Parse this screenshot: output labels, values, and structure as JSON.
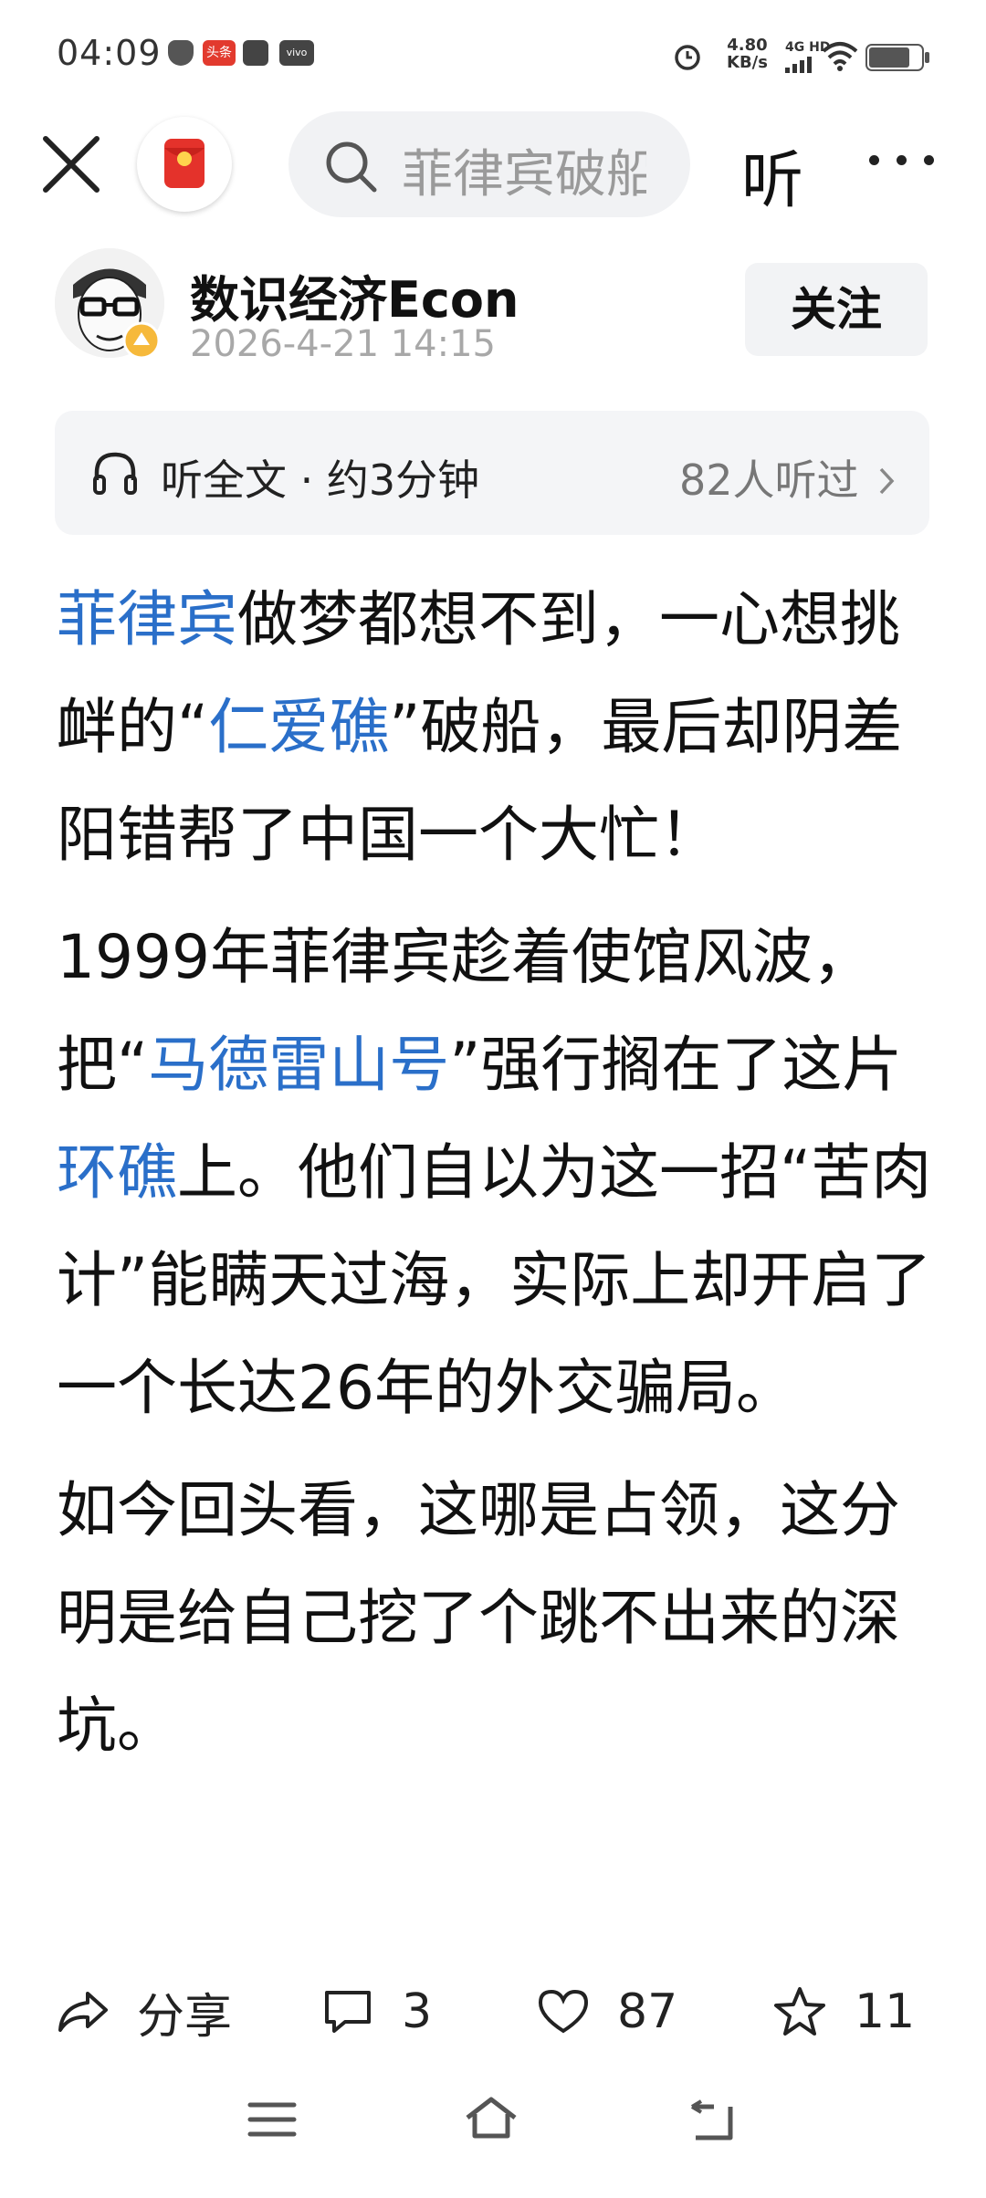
{
  "status_bar": {
    "time": "04:09",
    "app_badge": "头条",
    "vivo_label": "vivo",
    "speed_value": "4.80",
    "speed_unit": "KB/s",
    "network": "4G HD"
  },
  "header": {
    "search_text": "菲律宾破船",
    "listen_label": "听"
  },
  "author": {
    "name": "数识经济Econ",
    "date": "2026-4-21 14:15",
    "follow_label": "关注"
  },
  "listen_bar": {
    "label": "听全文 · 约3分钟",
    "count": "82人听过"
  },
  "article": {
    "p1_hl1": "菲律宾",
    "p1_t1": "做梦都想不到，一心想挑衅的“",
    "p1_hl2": "仁爱礁",
    "p1_t2": "”破船，最后却阴差阳错帮了中国一个大忙！",
    "p2_t1": "1999年菲律宾趁着使馆风波，把“",
    "p2_hl1": "马德雷山号",
    "p2_t2": "”强行搁在了这片",
    "p2_hl2": "环礁",
    "p2_t3": "上。他们自以为这一招“苦肉计”能瞒天过海，实际上却开启了一个长达26年的外交骗局。",
    "p3": "如今回头看，这哪是占领，这分明是给自己挖了个跳不出来的深坑。"
  },
  "actions": {
    "share_label": "分享",
    "comment_count": "3",
    "like_count": "87",
    "fav_count": "11"
  },
  "colors": {
    "link": "#2a6fc9",
    "logo_red": "#e4322b"
  }
}
